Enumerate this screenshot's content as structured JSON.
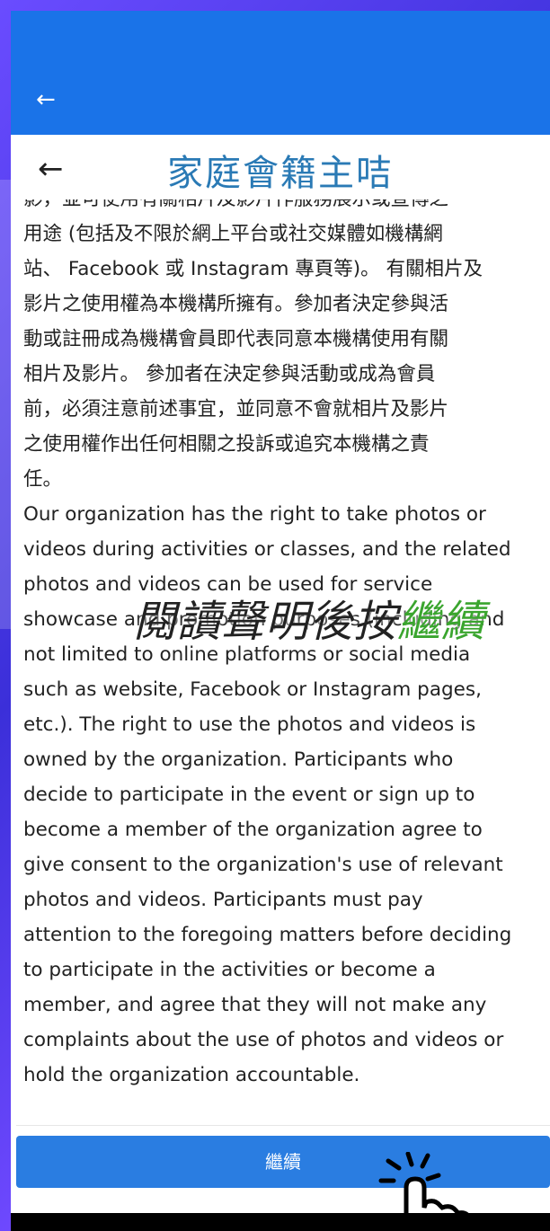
{
  "header": {
    "title": "家庭會籍主咭"
  },
  "content": {
    "cut_line": "影，並可使用有關相片及影片作服務展示或宣傳之",
    "zh_lines": [
      "用途 (包括及不限於網上平台或社交媒體如機構網",
      "站、 Facebook 或 Instagram 專頁等)。 有關相片及",
      "影片之使用權為本機構所擁有。參加者決定參與活",
      "動或註冊成為機構會員即代表同意本機構使用有關",
      "相片及影片。 參加者在決定參與活動或成為會員",
      "前，必須注意前述事宜，並同意不會就相片及影片",
      "之使用權作出任何相關之投訴或追究本機構之責",
      "任。"
    ],
    "en_lines": [
      "Our organization has the right to take photos or",
      "videos during activities or classes, and the related",
      "photos and videos can be used for service",
      "showcase and promotion purposes (including and",
      "not limited to online platforms or social media",
      "such as website, Facebook or Instagram pages,",
      "etc.). The right to use the photos and videos is",
      "owned by the organization. Participants who",
      "decide to participate in the event or sign up to",
      "become a member of the organization agree to",
      "give consent to the organization's use of relevant",
      "photos and videos. Participants must pay",
      "attention to the foregoing matters before deciding",
      "to participate in the activities or become a",
      "member, and agree that they will not make any",
      "complaints about the use of photos and videos or",
      "hold the organization accountable."
    ]
  },
  "overlay": {
    "prefix": "閱讀聲明後按",
    "highlight": "繼續"
  },
  "button": {
    "continue_label": "繼續"
  },
  "colors": {
    "primary": "#1a73e8",
    "title": "#2a7ab5",
    "highlight": "#3aa52e"
  }
}
